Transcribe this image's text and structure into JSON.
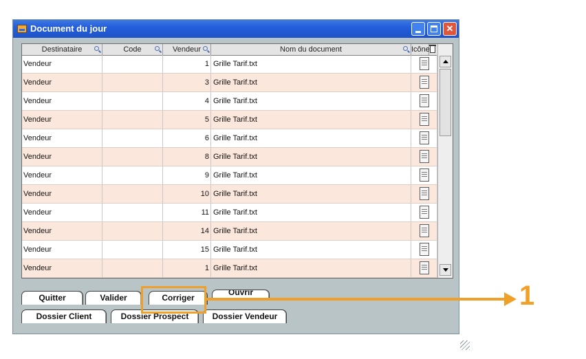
{
  "window": {
    "title": "Document du jour"
  },
  "table": {
    "headers": [
      "Destinataire",
      "Code",
      "Vendeur",
      "Nom du document",
      "Icône"
    ],
    "rows": [
      {
        "destinataire": "Vendeur",
        "code": "",
        "vendeur": "1",
        "document": "Grille Tarif.txt"
      },
      {
        "destinataire": "Vendeur",
        "code": "",
        "vendeur": "3",
        "document": "Grille Tarif.txt"
      },
      {
        "destinataire": "Vendeur",
        "code": "",
        "vendeur": "4",
        "document": "Grille Tarif.txt"
      },
      {
        "destinataire": "Vendeur",
        "code": "",
        "vendeur": "5",
        "document": "Grille Tarif.txt"
      },
      {
        "destinataire": "Vendeur",
        "code": "",
        "vendeur": "6",
        "document": "Grille Tarif.txt"
      },
      {
        "destinataire": "Vendeur",
        "code": "",
        "vendeur": "8",
        "document": "Grille Tarif.txt"
      },
      {
        "destinataire": "Vendeur",
        "code": "",
        "vendeur": "9",
        "document": "Grille Tarif.txt"
      },
      {
        "destinataire": "Vendeur",
        "code": "",
        "vendeur": "10",
        "document": "Grille Tarif.txt"
      },
      {
        "destinataire": "Vendeur",
        "code": "",
        "vendeur": "11",
        "document": "Grille Tarif.txt"
      },
      {
        "destinataire": "Vendeur",
        "code": "",
        "vendeur": "14",
        "document": "Grille Tarif.txt"
      },
      {
        "destinataire": "Vendeur",
        "code": "",
        "vendeur": "15",
        "document": "Grille Tarif.txt"
      },
      {
        "destinataire": "Vendeur",
        "code": "",
        "vendeur": "1",
        "document": "Grille Tarif.txt"
      }
    ],
    "row_icon": "text-file-icon",
    "alternate_row_color": "#fbe7dc"
  },
  "buttons": {
    "quitter": "Quitter",
    "valider": "Valider",
    "corriger": "Corriger",
    "ouvrir": "Ouvrir",
    "dossier_client": "Dossier Client",
    "dossier_prospect": "Dossier Prospect",
    "dossier_vendeur": "Dossier Vendeur"
  },
  "annotation": {
    "label": "1",
    "color": "#f0a028"
  }
}
